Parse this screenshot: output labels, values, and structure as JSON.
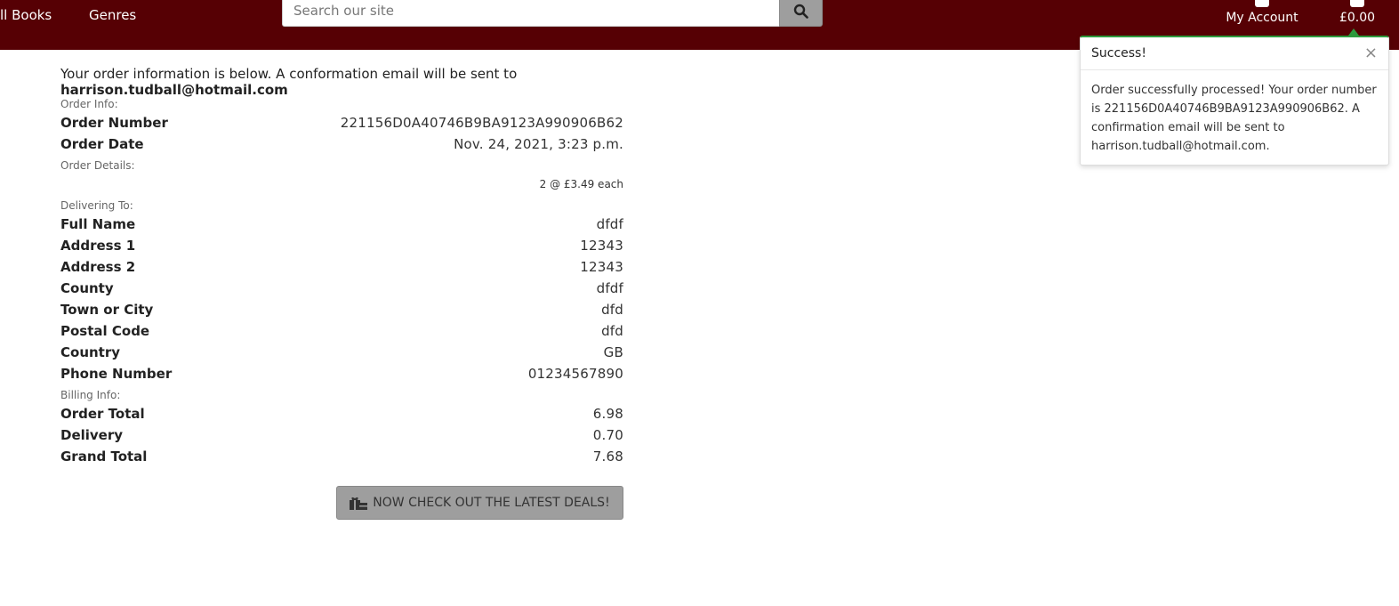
{
  "nav": {
    "all_books": "ll Books",
    "genres": "Genres",
    "search_placeholder": "Search our site",
    "my_account": "My Account",
    "basket_total": "£0.00"
  },
  "order": {
    "intro_text": "Your order information is below. A conformation email will be sent to ",
    "email": "harrison.tudball@hotmail.com",
    "order_info_label": "Order Info:",
    "order_number_label": "Order Number",
    "order_number": "221156D0A40746B9BA9123A990906B62",
    "order_date_label": "Order Date",
    "order_date": "Nov. 24, 2021, 3:23 p.m.",
    "order_details_label": "Order Details:",
    "line_item": "2 @ £3.49 each",
    "delivering_label": "Delivering To:",
    "delivery": [
      {
        "label": "Full Name",
        "value": "dfdf"
      },
      {
        "label": "Address 1",
        "value": "12343"
      },
      {
        "label": "Address 2",
        "value": "12343"
      },
      {
        "label": "County",
        "value": "dfdf"
      },
      {
        "label": "Town or City",
        "value": "dfd"
      },
      {
        "label": "Postal Code",
        "value": "dfd"
      },
      {
        "label": "Country",
        "value": "GB"
      },
      {
        "label": "Phone Number",
        "value": "01234567890"
      }
    ],
    "billing_label": "Billing Info:",
    "billing": [
      {
        "label": "Order Total",
        "value": "6.98"
      },
      {
        "label": "Delivery",
        "value": "0.70"
      },
      {
        "label": "Grand Total",
        "value": "7.68"
      }
    ],
    "cta_label": "NOW CHECK OUT THE LATEST DEALS!"
  },
  "toast": {
    "title": "Success!",
    "close": "×",
    "message": "Order successfully processed! Your order number is 221156D0A40746B9BA9123A990906B62. A confirmation email will be sent to harrison.tudball@hotmail.com.",
    "accent_color": "#2e9b3e"
  },
  "icons": {
    "search": "search-icon",
    "gift": "gift-icon",
    "account": "user-icon",
    "basket": "basket-icon"
  },
  "colors": {
    "header_bg": "#560004",
    "button_bg": "#9e9e9e"
  }
}
